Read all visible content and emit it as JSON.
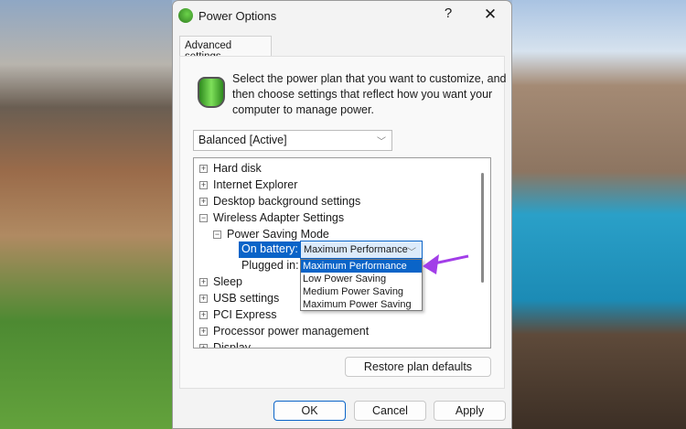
{
  "window": {
    "title": "Power Options",
    "help": "?",
    "close": "✕"
  },
  "tab": "Advanced settings",
  "description": "Select the power plan that you want to customize, and then choose settings that reflect how you want your computer to manage power.",
  "plan": {
    "value": "Balanced [Active]"
  },
  "tree": {
    "items": [
      {
        "label": "Hard disk",
        "sign": "+"
      },
      {
        "label": "Internet Explorer",
        "sign": "+"
      },
      {
        "label": "Desktop background settings",
        "sign": "+"
      },
      {
        "label": "Wireless Adapter Settings",
        "sign": "−"
      }
    ],
    "sub": {
      "label": "Power Saving Mode",
      "sign": "−"
    },
    "on_battery": "On battery:",
    "plugged_in": "Plugged in:",
    "combo_value": "Maximum Performance",
    "options": [
      "Maximum Performance",
      "Low Power Saving",
      "Medium Power Saving",
      "Maximum Power Saving"
    ],
    "after": [
      {
        "label": "Sleep",
        "sign": "+"
      },
      {
        "label": "USB settings",
        "sign": "+"
      },
      {
        "label": "PCI Express",
        "sign": "+"
      },
      {
        "label": "Processor power management",
        "sign": "+"
      },
      {
        "label": "Display",
        "sign": "+"
      }
    ]
  },
  "buttons": {
    "restore": "Restore plan defaults",
    "ok": "OK",
    "cancel": "Cancel",
    "apply": "Apply"
  },
  "colors": {
    "accent": "#0a64c8",
    "annotation_arrow": "#a23ee8"
  }
}
